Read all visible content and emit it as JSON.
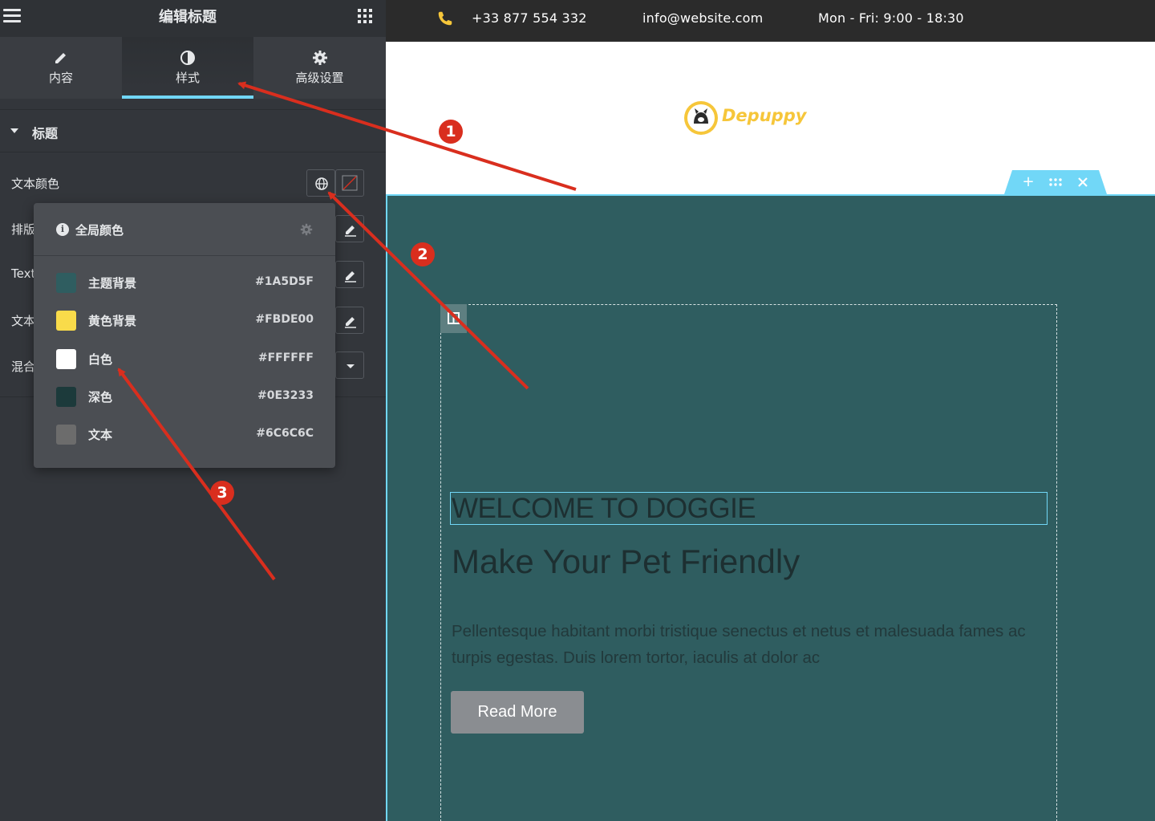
{
  "panel": {
    "title": "编辑标题",
    "tabs": [
      {
        "label": "内容",
        "icon": "pencil-icon"
      },
      {
        "label": "样式",
        "icon": "contrast-icon"
      },
      {
        "label": "高级设置",
        "icon": "gear-icon"
      }
    ],
    "section_title": "标题",
    "controls": [
      {
        "label": "文本颜色"
      },
      {
        "label": "排版"
      },
      {
        "label": "Text"
      },
      {
        "label": "文本"
      },
      {
        "label": "混合"
      }
    ]
  },
  "popover": {
    "title": "全局颜色",
    "colors": [
      {
        "name": "主题背景",
        "hex": "#1A5D5F",
        "swatch": "#2f5d60"
      },
      {
        "name": "黄色背景",
        "hex": "#FBDE00",
        "swatch": "#f9db4a"
      },
      {
        "name": "白色",
        "hex": "#FFFFFF",
        "swatch": "#ffffff"
      },
      {
        "name": "深色",
        "hex": "#0E3233",
        "swatch": "#1c3a3b"
      },
      {
        "name": "文本",
        "hex": "#6C6C6C",
        "swatch": "#6c6c6c"
      }
    ]
  },
  "topbar": {
    "phone": "+33 877 554 332",
    "email": "info@website.com",
    "hours": "Mon - Fri: 9:00 - 18:30"
  },
  "logo": {
    "text": "Depuppy"
  },
  "hero": {
    "eyebrow": "WELCOME TO DOGGIE",
    "title": "Make Your Pet Friendly",
    "text": "Pellentesque habitant morbi tristique senectus et netus et malesuada fames ac turpis egestas. Duis lorem tortor, iaculis at dolor ac",
    "button": "Read More"
  },
  "annotations": [
    {
      "label": "1"
    },
    {
      "label": "2"
    },
    {
      "label": "3"
    }
  ],
  "theme": {
    "accent": "#71d7f7",
    "arrow": "#d92e1e",
    "hero_bg": "#2f5d60"
  }
}
